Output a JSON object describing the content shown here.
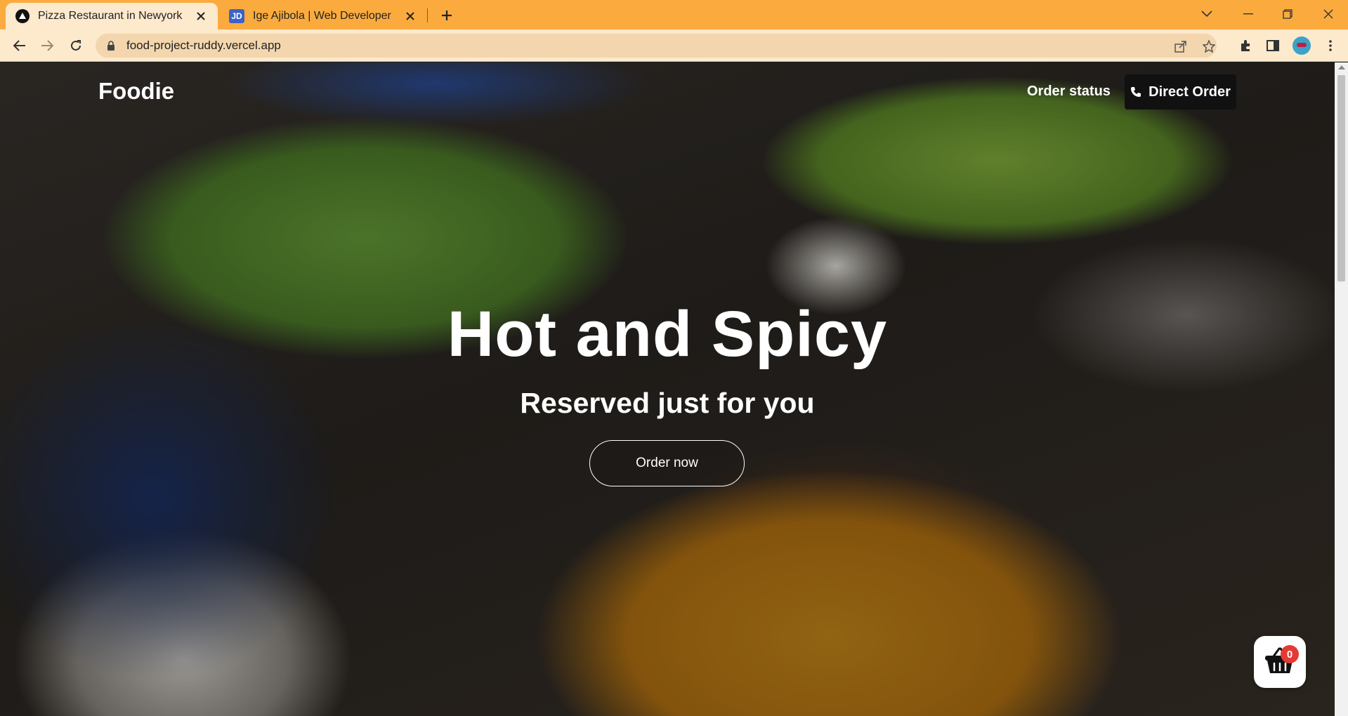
{
  "browser": {
    "tabs": [
      {
        "title": "Pizza Restaurant in Newyork",
        "active": true
      },
      {
        "title": "Ige Ajibola | Web Developer",
        "active": false,
        "favicon_text": "JD"
      }
    ],
    "url": "food-project-ruddy.vercel.app",
    "icons": [
      "back-icon",
      "forward-icon",
      "reload-icon",
      "lock-icon",
      "share-icon",
      "star-icon",
      "extensions-icon",
      "sidepanel-icon",
      "profile-avatar",
      "menu-icon"
    ]
  },
  "site": {
    "logo": "Foodie",
    "nav": {
      "order_status": "Order status",
      "direct_order": "Direct Order"
    },
    "hero": {
      "title": "Hot and Spicy",
      "subtitle": "Reserved just for you",
      "cta": "Order now"
    },
    "cart": {
      "count": "0"
    }
  },
  "colors": {
    "tab_strip": "#fbab3e",
    "toolbar": "#fde9cc",
    "direct_order_bg": "#111111",
    "cart_badge": "#e53935"
  }
}
